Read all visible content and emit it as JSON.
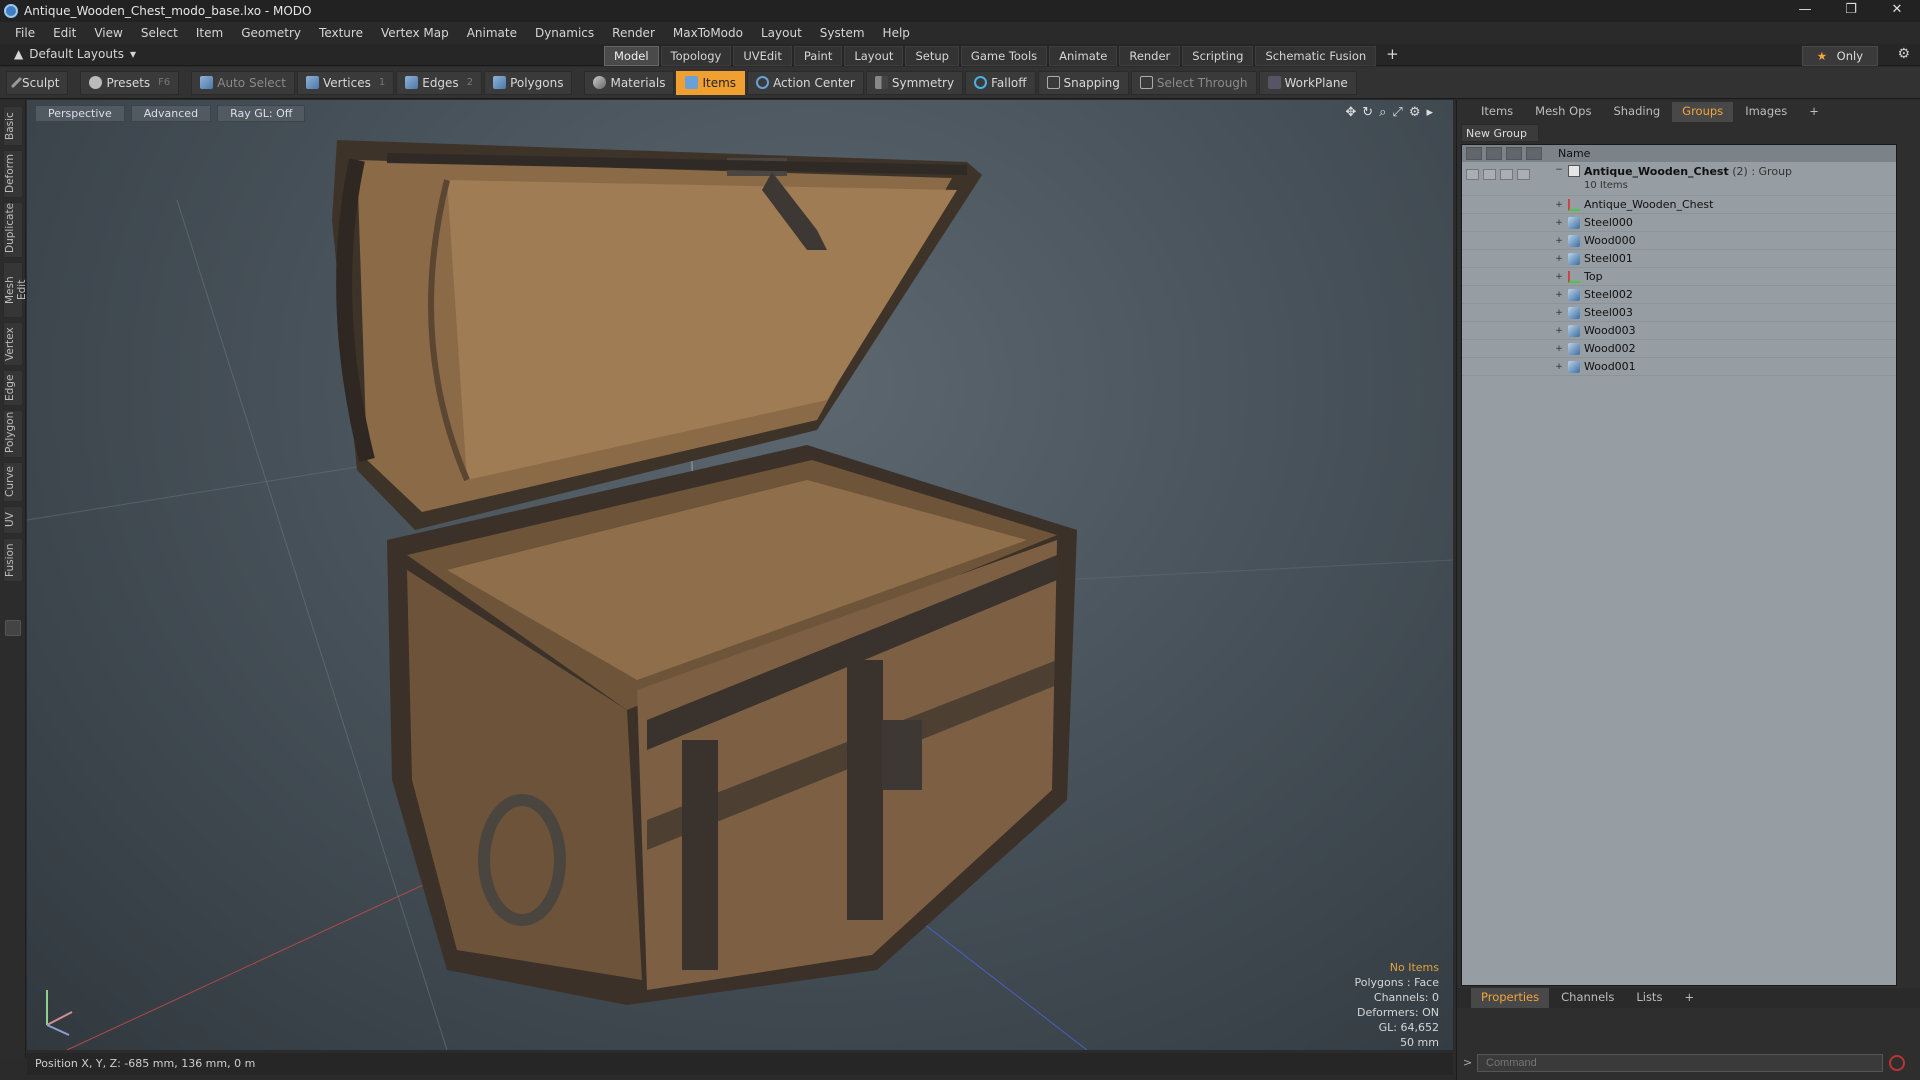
{
  "window": {
    "title": "Antique_Wooden_Chest_modo_base.lxo - MODO",
    "controls": [
      "—",
      "❐",
      "✕"
    ]
  },
  "menu": [
    "File",
    "Edit",
    "View",
    "Select",
    "Item",
    "Geometry",
    "Texture",
    "Vertex Map",
    "Animate",
    "Dynamics",
    "Render",
    "MaxToModo",
    "Layout",
    "System",
    "Help"
  ],
  "layoutbar": {
    "default_layouts": "Default Layouts",
    "tabs": [
      "Model",
      "Topology",
      "UVEdit",
      "Paint",
      "Layout",
      "Setup",
      "Game Tools",
      "Animate",
      "Render",
      "Scripting",
      "Schematic Fusion"
    ],
    "active_tab": "Model",
    "add": "+",
    "only": "Only"
  },
  "toolbar": {
    "sculpt": "Sculpt",
    "presets": "Presets",
    "presets_key": "F6",
    "auto_select": "Auto Select",
    "vertices": "Vertices",
    "vertices_key": "1",
    "edges": "Edges",
    "edges_key": "2",
    "polygons": "Polygons",
    "materials": "Materials",
    "items": "Items",
    "action_center": "Action Center",
    "symmetry": "Symmetry",
    "falloff": "Falloff",
    "snapping": "Snapping",
    "select_through": "Select Through",
    "workplane": "WorkPlane"
  },
  "left_tabs": [
    "Basic",
    "Deform",
    "Duplicate",
    "Mesh Edit",
    "Vertex",
    "Edge",
    "Polygon",
    "Curve",
    "UV",
    "Fusion"
  ],
  "viewport": {
    "buttons": [
      "Perspective",
      "Advanced",
      "Ray GL: Off"
    ],
    "hud": {
      "no_items": "No Items",
      "polygons": "Polygons : Face",
      "channels": "Channels: 0",
      "deformers": "Deformers: ON",
      "gl": "GL: 64,652",
      "scale": "50 mm"
    }
  },
  "status": {
    "position": "Position X, Y, Z:  -685 mm, 136 mm, 0 m"
  },
  "right_panel": {
    "tabs": [
      "Items",
      "Mesh Ops",
      "Shading",
      "Groups",
      "Images"
    ],
    "active_tab": "Groups",
    "add": "+",
    "new_group": "New Group",
    "column_name": "Name",
    "group": {
      "name": "Antique_Wooden_Chest",
      "count": "(2)",
      "type": ": Group",
      "items_label": "10 Items"
    },
    "items": [
      {
        "name": "Antique_Wooden_Chest",
        "kind": "locator"
      },
      {
        "name": "Steel000",
        "kind": "mesh"
      },
      {
        "name": "Wood000",
        "kind": "mesh"
      },
      {
        "name": "Steel001",
        "kind": "mesh"
      },
      {
        "name": "Top",
        "kind": "locator"
      },
      {
        "name": "Steel002",
        "kind": "mesh"
      },
      {
        "name": "Steel003",
        "kind": "mesh"
      },
      {
        "name": "Wood003",
        "kind": "mesh"
      },
      {
        "name": "Wood002",
        "kind": "mesh"
      },
      {
        "name": "Wood001",
        "kind": "mesh"
      }
    ],
    "bottom_tabs": [
      "Properties",
      "Channels",
      "Lists"
    ],
    "bottom_active": "Properties",
    "command_placeholder": "Command"
  },
  "colors": {
    "accent": "#f0a030",
    "viewport_bg": "#48525a",
    "tree_bg": "#969da3"
  }
}
